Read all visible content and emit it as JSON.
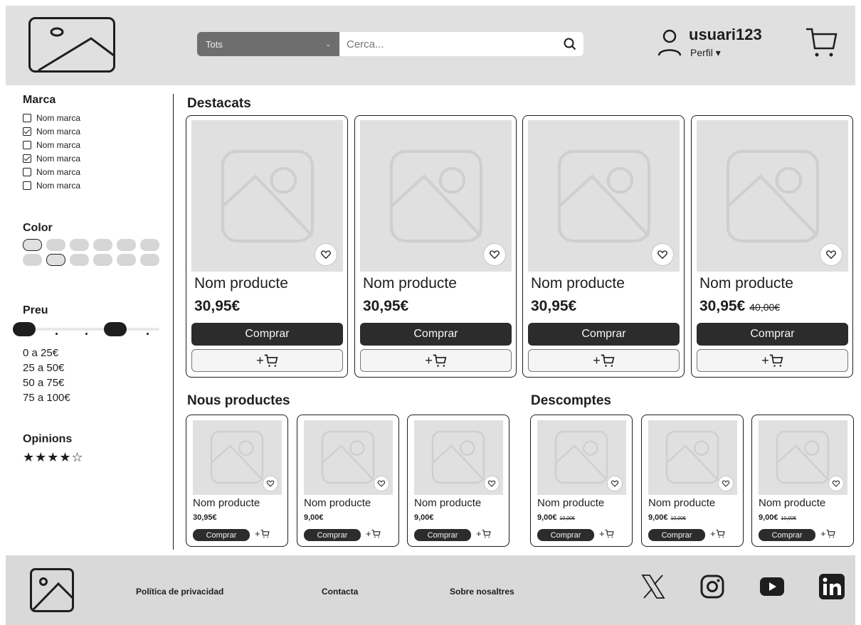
{
  "header": {
    "category_select": "Tots",
    "search_placeholder": "Cerca...",
    "username": "usuari123",
    "profile_label": "Perfil"
  },
  "sidebar": {
    "brand_title": "Marca",
    "brands": [
      {
        "label": "Nom marca",
        "checked": false
      },
      {
        "label": "Nom marca",
        "checked": true
      },
      {
        "label": "Nom marca",
        "checked": false
      },
      {
        "label": "Nom marca",
        "checked": true
      },
      {
        "label": "Nom marca",
        "checked": false
      },
      {
        "label": "Nom marca",
        "checked": false
      }
    ],
    "color_title": "Color",
    "price_title": "Preu",
    "price_ranges": [
      "0 a 25€",
      "25 a 50€",
      "50 a 75€",
      "75 a 100€"
    ],
    "opinions_title": "Opinions",
    "stars": "★★★★☆"
  },
  "featured": {
    "title": "Destacats",
    "products": [
      {
        "name": "Nom producte",
        "price": "30,95€",
        "old_price": "",
        "buy": "Comprar",
        "add": "+"
      },
      {
        "name": "Nom producte",
        "price": "30,95€",
        "old_price": "",
        "buy": "Comprar",
        "add": "+"
      },
      {
        "name": "Nom producte",
        "price": "30,95€",
        "old_price": "",
        "buy": "Comprar",
        "add": "+"
      },
      {
        "name": "Nom producte",
        "price": "30,95€",
        "old_price": "40,00€",
        "buy": "Comprar",
        "add": "+"
      }
    ]
  },
  "new_products": {
    "title": "Nous productes",
    "products": [
      {
        "name": "Nom producte",
        "price": "30,95€",
        "old_price": "",
        "buy": "Comprar",
        "add": "+"
      },
      {
        "name": "Nom producte",
        "price": "9,00€",
        "old_price": "",
        "buy": "Comprar",
        "add": "+"
      },
      {
        "name": "Nom producte",
        "price": "9,00€",
        "old_price": "",
        "buy": "Comprar",
        "add": "+"
      }
    ]
  },
  "discounts": {
    "title": "Descomptes",
    "products": [
      {
        "name": "Nom producte",
        "price": "9,00€",
        "old_price": "10,00€",
        "buy": "Comprar",
        "add": "+"
      },
      {
        "name": "Nom producte",
        "price": "9,00€",
        "old_price": "10,00€",
        "buy": "Comprar",
        "add": "+"
      },
      {
        "name": "Nom producte",
        "price": "9,00€",
        "old_price": "10,00€",
        "buy": "Comprar",
        "add": "+"
      }
    ]
  },
  "footer": {
    "links": [
      "Política de privacidad",
      "Contacta",
      "Sobre nosaltres"
    ]
  }
}
